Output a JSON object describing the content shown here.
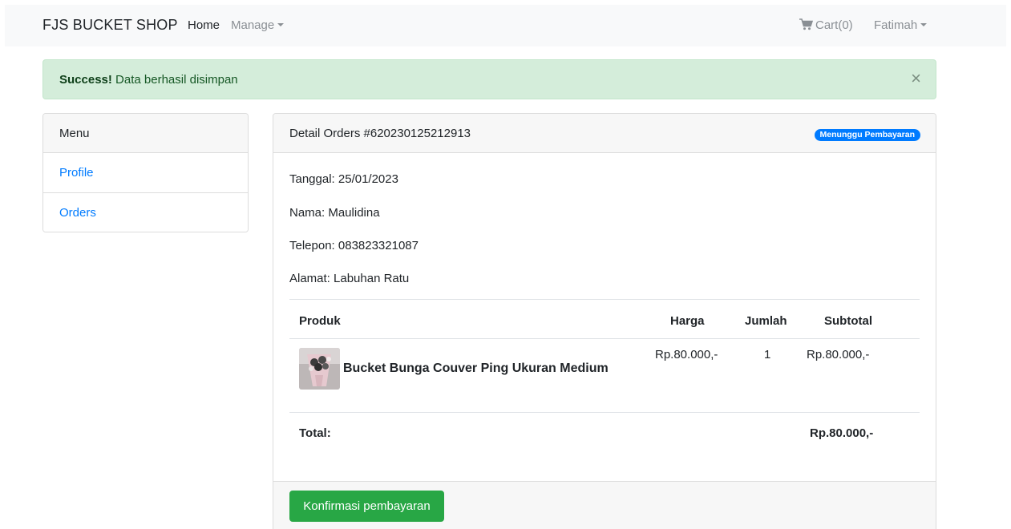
{
  "navbar": {
    "brand": "FJS BUCKET SHOP",
    "home": "Home",
    "manage": "Manage",
    "cart": "Cart(0)",
    "user": "Fatimah"
  },
  "alert": {
    "strong": "Success!",
    "message": "Data berhasil disimpan",
    "close": "×"
  },
  "sidebar": {
    "header": "Menu",
    "items": [
      {
        "label": "Profile"
      },
      {
        "label": "Orders"
      }
    ]
  },
  "order": {
    "title": "Detail Orders #620230125212913",
    "status": "Menunggu Pembayaran",
    "tanggal": "Tanggal: 25/01/2023",
    "nama": "Nama: Maulidina",
    "telepon": "Telepon: 083823321087",
    "alamat": "Alamat: Labuhan Ratu",
    "columns": {
      "produk": "Produk",
      "harga": "Harga",
      "jumlah": "Jumlah",
      "subtotal": "Subtotal"
    },
    "items": [
      {
        "name": "Bucket Bunga Couver Ping Ukuran Medium",
        "harga": "Rp.80.000,-",
        "jumlah": "1",
        "subtotal": "Rp.80.000,-"
      }
    ],
    "total_label": "Total:",
    "total_value": "Rp.80.000,-",
    "confirm_button": "Konfirmasi pembayaran"
  },
  "colors": {
    "primary": "#007bff",
    "success": "#28a745",
    "alert_bg": "#d4edda"
  }
}
